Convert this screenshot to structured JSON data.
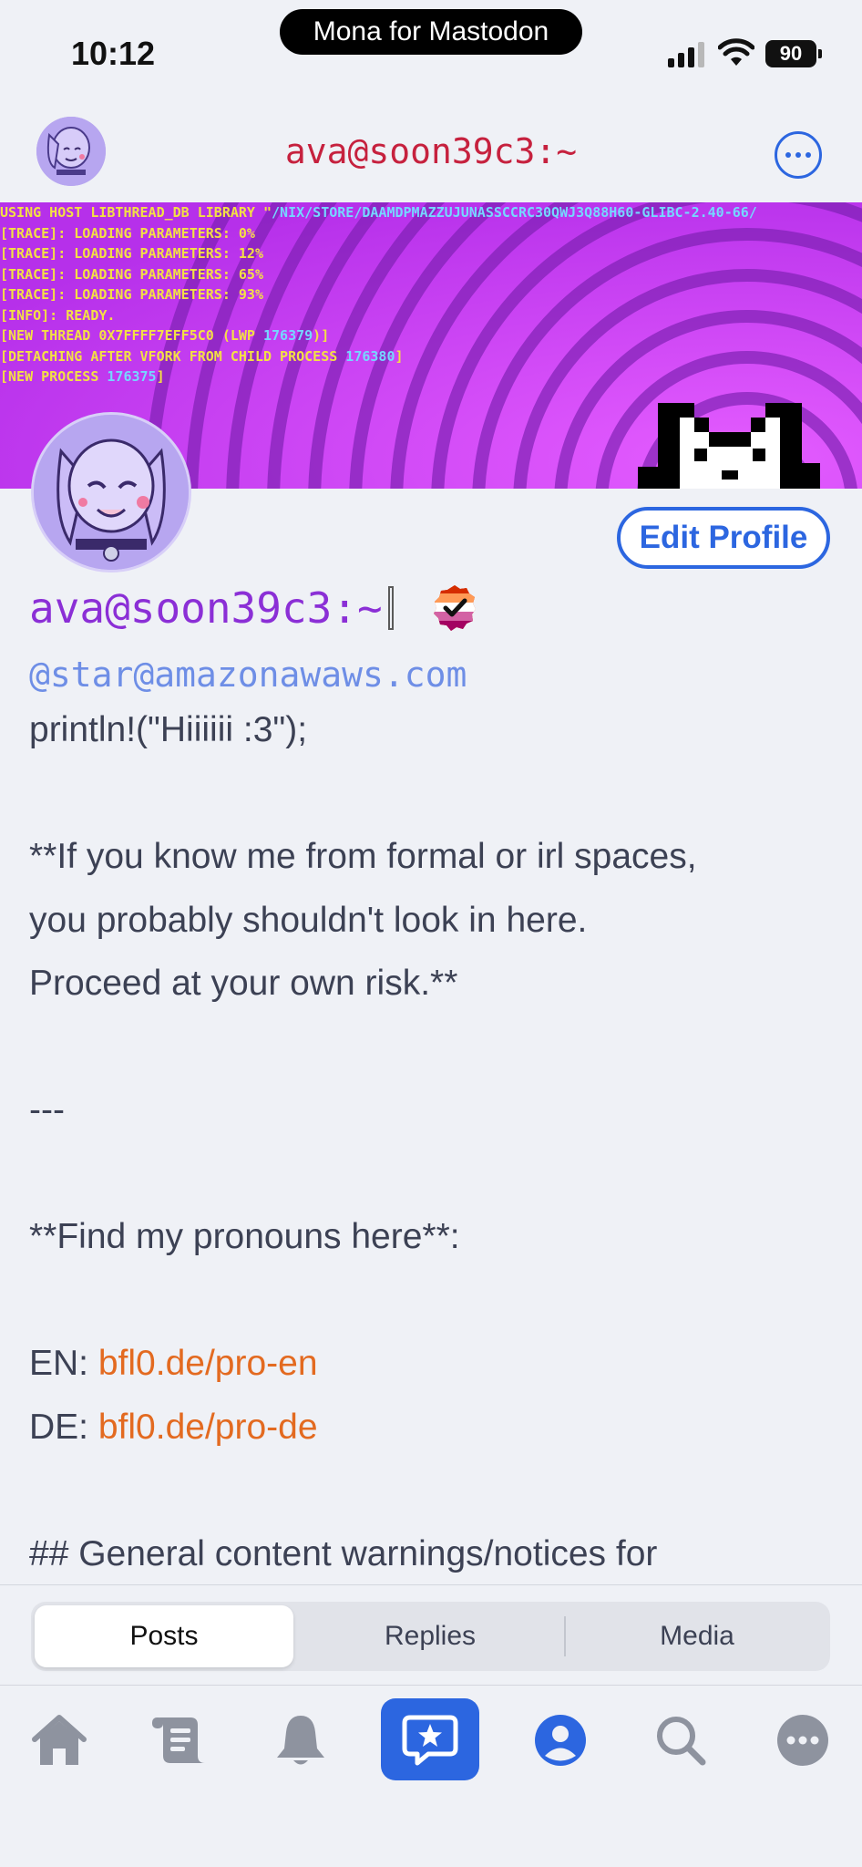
{
  "status_bar": {
    "time": "10:12",
    "app_indicator": "Mona for Mastodon",
    "battery": "90",
    "icons": [
      "signal-icon",
      "wifi-icon",
      "battery-icon"
    ]
  },
  "nav": {
    "title": "ava@soon39c3:~",
    "more_icon": "ellipsis-circle-icon"
  },
  "banner": {
    "log_lines": [
      "USING HOST LIBTHREAD_DB LIBRARY \"/NIX/STORE/DAAMDPMAZZUJUNASSCCRC30QWJ3Q88H60-GLIBC-2.40-66/",
      "[TRACE]: LOADING PARAMETERS: 0%",
      "[TRACE]: LOADING PARAMETERS: 12%",
      "[TRACE]: LOADING PARAMETERS: 65%",
      "[TRACE]: LOADING PARAMETERS: 93%",
      "[INFO]: READY.",
      "[NEW THREAD 0X7FFFF7EFF5C0 (LWP 176379)]",
      "[DETACHING AFTER VFORK FROM CHILD PROCESS 176380]",
      "[NEW PROCESS 176375]"
    ],
    "highlight_tokens": [
      "/NIX/STORE/DAAMDPMAZZUJUNASSCCRC30QWJ3Q88H60-GLIBC-2.40-66/",
      "176379",
      "176380",
      "176375"
    ]
  },
  "profile": {
    "display_name": "ava@soon39c3:~",
    "handle": "@star@amazonawaws.com",
    "edit_button": "Edit Profile",
    "bio_lines": [
      {
        "text": "println!(\"Hiiiiii :3\");"
      },
      {
        "text": ""
      },
      {
        "text": "**If you know me from formal or irl spaces,"
      },
      {
        "text": "you probably shouldn't look in here."
      },
      {
        "text": "Proceed at your own risk.**"
      },
      {
        "text": ""
      },
      {
        "text": "---"
      },
      {
        "text": ""
      },
      {
        "text": "**Find my pronouns here**:"
      },
      {
        "text": ""
      },
      {
        "prefix": "EN: ",
        "link": "bfl0.de/pro-en"
      },
      {
        "prefix": "DE: ",
        "link": "bfl0.de/pro-de"
      },
      {
        "text": ""
      },
      {
        "text": "## General content warnings/notices for"
      }
    ]
  },
  "segments": {
    "items": [
      "Posts",
      "Replies",
      "Media"
    ],
    "selected": "Posts"
  },
  "tabbar": {
    "items": [
      "home-icon",
      "feed-icon",
      "bell-icon",
      "compose-icon",
      "profile-icon",
      "search-icon",
      "more-icon"
    ],
    "active": "compose-icon"
  },
  "colors": {
    "accent": "#2c66e0",
    "title_red": "#c6213e",
    "display_name_purple": "#8b2fd6",
    "handle_blue": "#6e8ee6",
    "link_orange": "#e36a20",
    "background": "#eff1f6"
  }
}
